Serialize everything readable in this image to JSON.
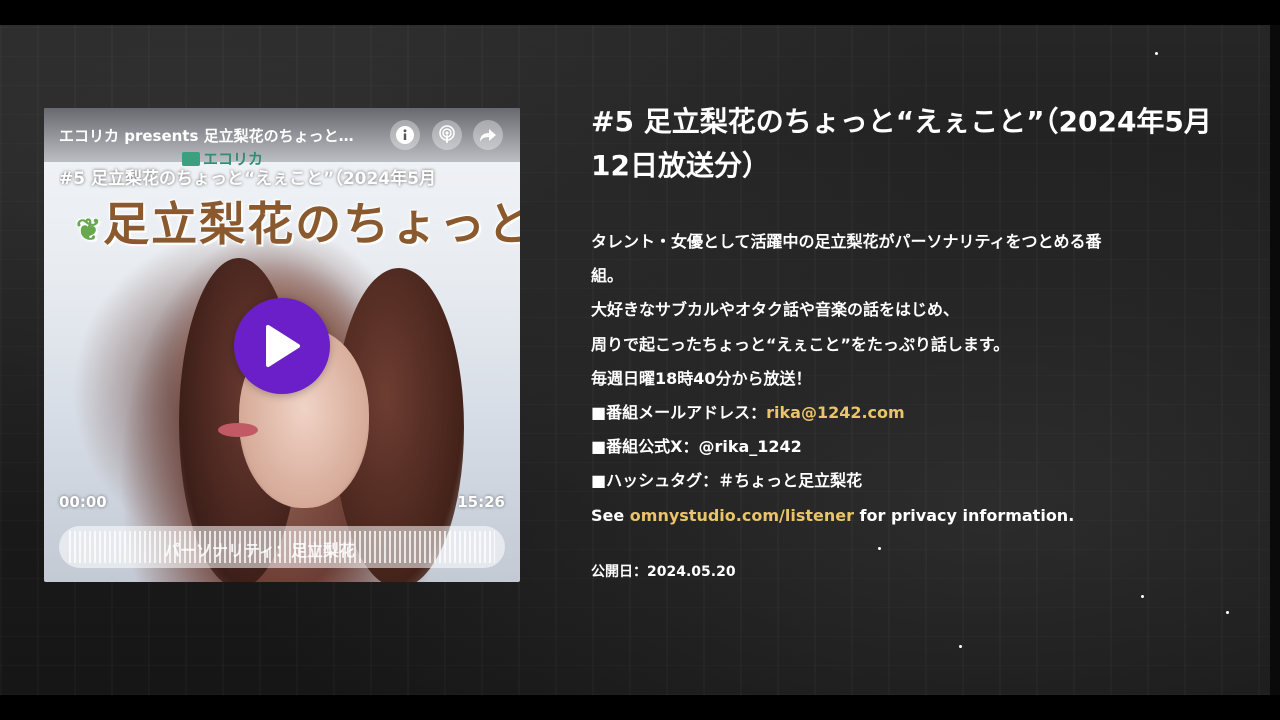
{
  "player": {
    "show_title": "エコリカ presents 足立梨花のちょっと…",
    "logo_small_text": "エコリカ",
    "episode_subtitle": "#5 足立梨花のちょっと“えぇこと”（2024年5月",
    "logo_art_text": "足立梨花のちょっと“えぇこと”",
    "current_time": "00:00",
    "duration": "15:26",
    "waveform_caption": "パーソナリティ：足立梨花",
    "progress": 0,
    "icons": [
      "info-icon",
      "podcast-icon",
      "share-icon",
      "play-icon"
    ],
    "accent_color": "#6b1fc9"
  },
  "episode": {
    "title": "#5 足立梨花のちょっと“えぇこと”（2024年5月12日放送分）",
    "description_lines": [
      "タレント・女優として活躍中の足立梨花がパーソナリティをつとめる番",
      "組。",
      "大好きなサブカルやオタク話や音楽の話をはじめ、",
      "周りで起こったちょっと“えぇこと”をたっぷり話します。",
      "毎週日曜18時40分から放送！"
    ],
    "mail_prefix": "■番組メールアドレス：",
    "mail_link": "rika@1242.com",
    "x_line": "■番組公式X：@rika_1242",
    "hashtag_line": "■ハッシュタグ：＃ちょっと足立梨花",
    "privacy_prefix": "See ",
    "privacy_link": "omnystudio.com/listener",
    "privacy_suffix": " for privacy information.",
    "published": "公開日：2024.05.20",
    "link_color": "#e9c46a"
  }
}
